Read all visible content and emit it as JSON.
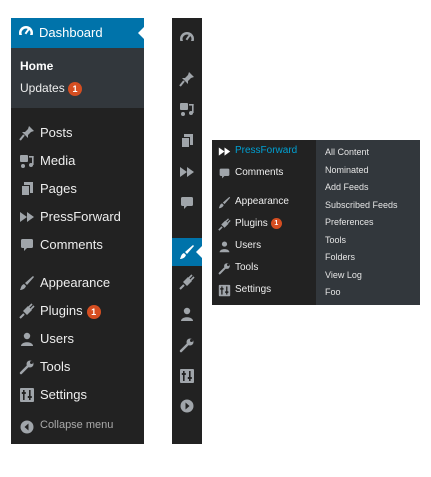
{
  "colors": {
    "menu_bg": "#222222",
    "submenu_bg": "#32373c",
    "active_bg": "#0073aa",
    "badge_bg": "#d54e21",
    "current_text": "#00a0d2"
  },
  "expanded_menu": {
    "dashboard_label": "Dashboard",
    "submenu": {
      "home": "Home",
      "updates": "Updates",
      "updates_count": "1"
    },
    "items": [
      {
        "label": "Posts",
        "icon": "pin-icon"
      },
      {
        "label": "Media",
        "icon": "media-icon"
      },
      {
        "label": "Pages",
        "icon": "pages-icon"
      },
      {
        "label": "PressForward",
        "icon": "fast-forward-icon"
      },
      {
        "label": "Comments",
        "icon": "comment-icon"
      },
      {
        "label": "Appearance",
        "icon": "brush-icon"
      },
      {
        "label": "Plugins",
        "icon": "plug-icon",
        "count": "1"
      },
      {
        "label": "Users",
        "icon": "user-icon"
      },
      {
        "label": "Tools",
        "icon": "wrench-icon"
      },
      {
        "label": "Settings",
        "icon": "settings-icon"
      }
    ],
    "collapse_label": "Collapse menu"
  },
  "flyout_menu": {
    "items": [
      {
        "label": "PressForward",
        "icon": "fast-forward-icon"
      },
      {
        "label": "Comments",
        "icon": "comment-icon"
      },
      {
        "label": "Appearance",
        "icon": "brush-icon"
      },
      {
        "label": "Plugins",
        "icon": "plug-icon",
        "count": "1"
      },
      {
        "label": "Users",
        "icon": "user-icon"
      },
      {
        "label": "Tools",
        "icon": "wrench-icon"
      },
      {
        "label": "Settings",
        "icon": "settings-icon"
      }
    ],
    "submenu": [
      "All Content",
      "Nominated",
      "Add Feeds",
      "Subscribed Feeds",
      "Preferences",
      "Tools",
      "Folders",
      "View Log",
      "Foo"
    ]
  }
}
